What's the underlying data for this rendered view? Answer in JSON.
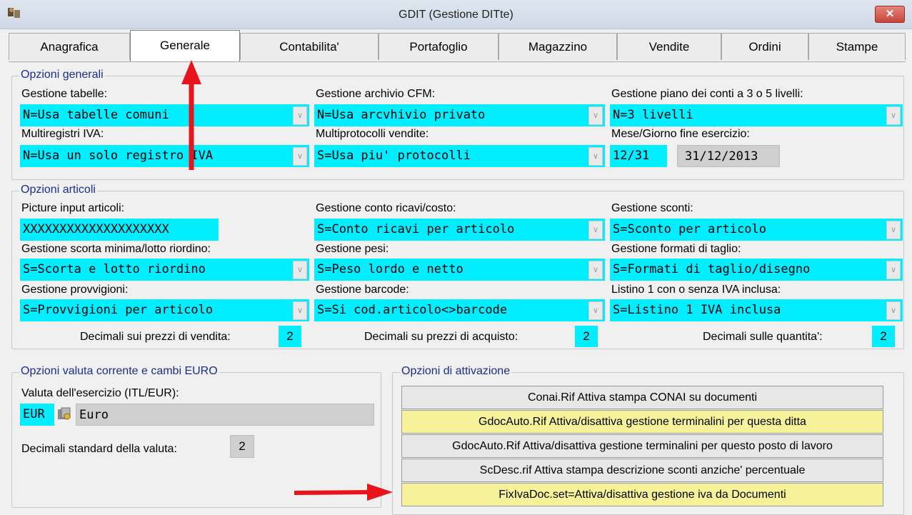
{
  "window": {
    "title": "GDIT (Gestione DITte)",
    "close_label": "✕"
  },
  "tabs": [
    "Anagrafica",
    "Generale",
    "Contabilita'",
    "Portafoglio",
    "Magazzino",
    "Vendite",
    "Ordini",
    "Stampe"
  ],
  "active_tab": "Generale",
  "opzioni_generali": {
    "title": "Opzioni generali",
    "gestione_tabelle": {
      "label": "Gestione tabelle:",
      "value": "N=Usa tabelle comuni"
    },
    "gestione_archivio_cfm": {
      "label": "Gestione archivio CFM:",
      "value": "N=Usa arcvhivio privato"
    },
    "gestione_piano_conti": {
      "label": "Gestione piano dei conti a 3 o 5 livelli:",
      "value": "N=3 livelli"
    },
    "multiregistri_iva": {
      "label": "Multiregistri IVA:",
      "value": "N=Usa un solo registro IVA"
    },
    "multiprotocolli_vendite": {
      "label": "Multiprotocolli vendite:",
      "value": "S=Usa piu' protocolli"
    },
    "mese_giorno_fine": {
      "label": "Mese/Giorno fine esercizio:",
      "value": "12/31",
      "date": "31/12/2013"
    }
  },
  "opzioni_articoli": {
    "title": "Opzioni articoli",
    "picture_input": {
      "label": "Picture input articoli:",
      "value": "XXXXXXXXXXXXXXXXXXXX"
    },
    "conto_ricavi": {
      "label": "Gestione conto ricavi/costo:",
      "value": "S=Conto ricavi per articolo"
    },
    "sconti": {
      "label": "Gestione sconti:",
      "value": "S=Sconto per articolo"
    },
    "scorta_minima": {
      "label": "Gestione scorta minima/lotto riordino:",
      "value": "S=Scorta e lotto riordino"
    },
    "pesi": {
      "label": "Gestione pesi:",
      "value": "S=Peso lordo e netto"
    },
    "formati_taglio": {
      "label": "Gestione formati di taglio:",
      "value": "S=Formati di taglio/disegno"
    },
    "provvigioni": {
      "label": "Gestione provvigioni:",
      "value": "S=Provvigioni per articolo"
    },
    "barcode": {
      "label": "Gestione barcode:",
      "value": "S=Si cod.articolo<>barcode"
    },
    "listino": {
      "label": "Listino 1 con o senza IVA inclusa:",
      "value": "S=Listino 1 IVA inclusa"
    },
    "decimali_vendita": {
      "label": "Decimali sui prezzi di vendita:",
      "value": "2"
    },
    "decimali_acquisto": {
      "label": "Decimali su prezzi di acquisto:",
      "value": "2"
    },
    "decimali_quantita": {
      "label": "Decimali sulle quantita':",
      "value": "2"
    }
  },
  "opzioni_valuta": {
    "title": "Opzioni valuta corrente e cambi EURO",
    "valuta_label": "Valuta dell'esercizio (ITL/EUR):",
    "valuta_code": "EUR",
    "valuta_name": "Euro",
    "decimali_label": "Decimali standard della valuta:",
    "decimali_value": "2"
  },
  "opzioni_attivazione": {
    "title": "Opzioni di attivazione",
    "buttons": [
      "Conai.Rif Attiva stampa CONAI su documenti",
      "GdocAuto.Rif Attiva/disattiva gestione terminalini per questa ditta",
      "GdocAuto.Rif Attiva/disattiva gestione terminalini per questo posto di lavoro",
      "ScDesc.rif Attiva stampa descrizione sconti anziche' percentuale",
      "FixIvaDoc.set=Attiva/disattiva gestione iva da Documenti"
    ]
  },
  "colors": {
    "field_cyan": "#00eeff",
    "highlight_yellow": "#f6f29a",
    "group_title": "#1a2e8a",
    "annotation_arrow": "#e8141c"
  },
  "icons": {
    "app": "app-icon",
    "currency_lookup": "currency-lookup-icon"
  }
}
